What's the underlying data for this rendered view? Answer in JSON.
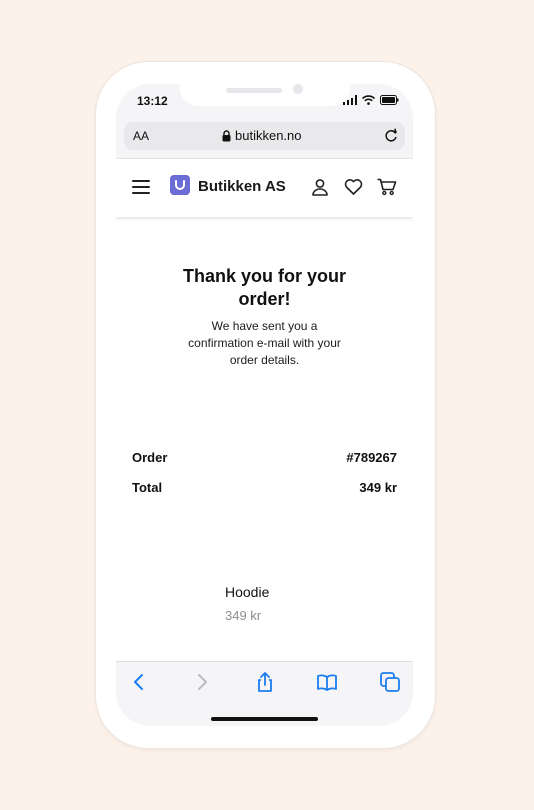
{
  "status_bar": {
    "time": "13:12"
  },
  "browser": {
    "text_size_label": "AA",
    "url": "butikken.no"
  },
  "site": {
    "brand": "Butikken AS"
  },
  "confirmation": {
    "title_line1": "Thank you for your",
    "title_line2": "order!",
    "message_line1": "We have sent you a",
    "message_line2": "confirmation e-mail with your",
    "message_line3": "order details."
  },
  "summary": [
    {
      "label": "Order",
      "value": "#789267"
    },
    {
      "label": "Total",
      "value": "349 kr"
    }
  ],
  "item": {
    "name": "Hoodie",
    "price": "349 kr"
  },
  "colors": {
    "accent": "#6b6cd5",
    "ios_blue": "#1a7cf0",
    "background": "#fdf2ea"
  },
  "icons": [
    "hamburger-icon",
    "bag-logo-icon",
    "user-icon",
    "heart-icon",
    "cart-icon",
    "lock-icon",
    "reload-icon",
    "back-icon",
    "forward-icon",
    "share-icon",
    "bookmarks-icon",
    "tabs-icon"
  ]
}
